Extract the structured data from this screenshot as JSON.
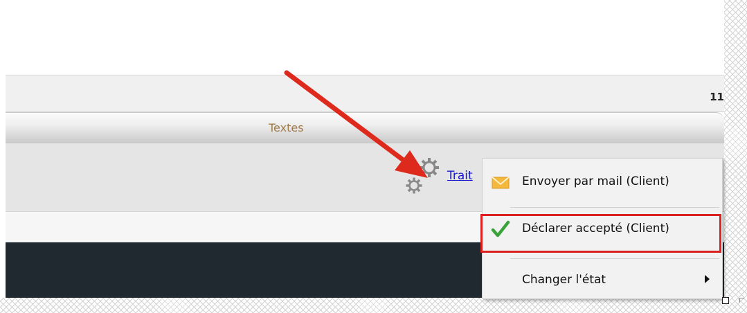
{
  "header": {
    "corner_number": "11"
  },
  "column_header": {
    "title": "Textes"
  },
  "row": {
    "link_text": "Trait",
    "icon": "gears-icon"
  },
  "context_menu": {
    "items": [
      {
        "label": "Envoyer par mail (Client)",
        "icon": "envelope-icon"
      },
      {
        "label": "Déclarer accepté (Client)",
        "icon": "checkmark-icon",
        "highlighted": true
      },
      {
        "label": "Changer l'état",
        "icon": "",
        "has_submenu": true
      }
    ]
  },
  "annotation": {
    "arrow_color": "#dd2a1c",
    "highlight_color": "#dc2020"
  },
  "colors": {
    "link": "#1717cc",
    "column_title": "#a07a4a",
    "dark_bar": "#20292f",
    "envelope": "#f3b83c",
    "checkmark": "#3aa23a"
  }
}
